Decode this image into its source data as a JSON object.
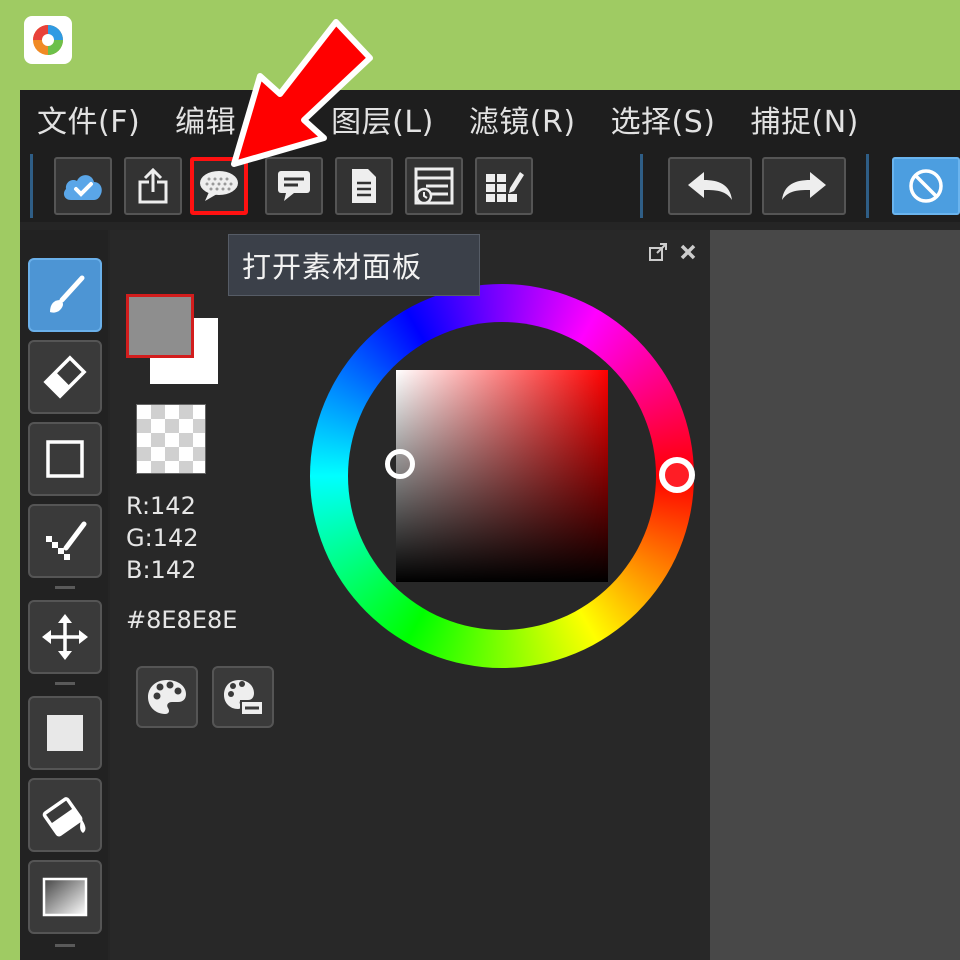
{
  "app": {
    "icon_name": "medibang-logo-icon"
  },
  "menubar": {
    "items": [
      {
        "label": "文件(F)"
      },
      {
        "label": "编辑"
      },
      {
        "label": "图层(L)"
      },
      {
        "label": "滤镜(R)"
      },
      {
        "label": "选择(S)"
      },
      {
        "label": "捕捉(N)"
      }
    ]
  },
  "toolbar": {
    "buttons": [
      {
        "name": "cloud-sync",
        "icon": "cloud-check-icon"
      },
      {
        "name": "share",
        "icon": "share-upload-icon"
      },
      {
        "name": "material-panel",
        "icon": "speech-bubble-icon",
        "highlighted": true
      },
      {
        "name": "comment",
        "icon": "comment-icon"
      },
      {
        "name": "page",
        "icon": "document-icon"
      },
      {
        "name": "page-manager",
        "icon": "page-list-icon"
      },
      {
        "name": "edit-grid",
        "icon": "grid-edit-icon"
      },
      {
        "name": "undo",
        "icon": "undo-arrow-icon"
      },
      {
        "name": "redo",
        "icon": "redo-arrow-icon"
      },
      {
        "name": "no-entry",
        "icon": "prohibited-icon"
      }
    ],
    "tooltip": "打开素材面板"
  },
  "tools": [
    {
      "name": "brush",
      "icon": "brush-icon",
      "active": true
    },
    {
      "name": "eraser",
      "icon": "eraser-icon"
    },
    {
      "name": "rectangle",
      "icon": "rectangle-icon"
    },
    {
      "name": "dot-pen",
      "icon": "dot-pen-icon"
    },
    {
      "name": "move",
      "icon": "move-arrows-icon"
    },
    {
      "name": "fill-shape",
      "icon": "square-fill-icon"
    },
    {
      "name": "bucket",
      "icon": "paint-bucket-icon"
    },
    {
      "name": "gradient",
      "icon": "gradient-icon"
    }
  ],
  "color": {
    "foreground": "#8e8e8e",
    "background": "#ffffff",
    "r_label": "R:142",
    "g_label": "G:142",
    "b_label": "B:142",
    "hex_label": "#8E8E8E",
    "hue": "#ff0000",
    "palette_buttons": [
      {
        "icon": "palette-icon"
      },
      {
        "icon": "palette-settings-icon"
      }
    ]
  },
  "colors": {
    "window_bg": "#252525",
    "outer_bg": "#9fcb63",
    "accent_blue": "#4d95d4",
    "highlight_red": "#ff1111"
  }
}
